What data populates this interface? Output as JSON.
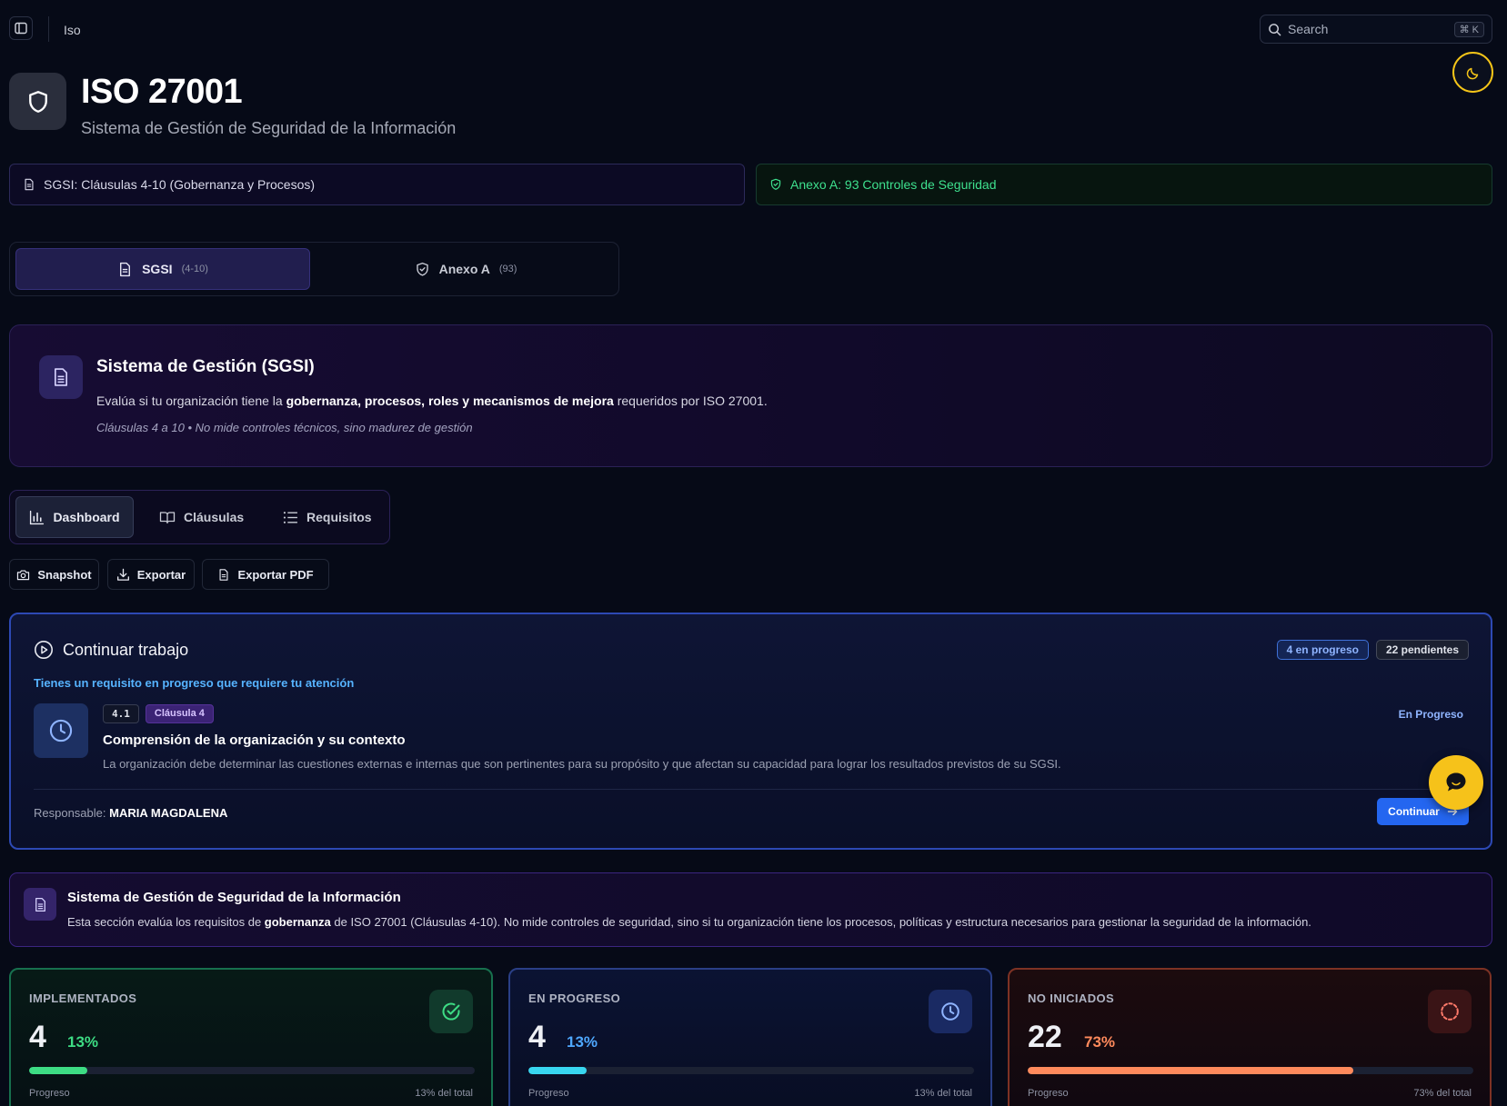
{
  "topbar": {
    "breadcrumb": "Iso",
    "search_placeholder": "Search",
    "search_shortcut": "⌘ K"
  },
  "header": {
    "title": "ISO 27001",
    "subtitle": "Sistema de Gestión de Seguridad de la Información",
    "icon": "shield-icon"
  },
  "sections": {
    "sgsi_label": "SGSI: Cláusulas 4-10 (Gobernanza y Procesos)",
    "anexo_label": "Anexo A: 93 Controles de Seguridad"
  },
  "tabs": [
    {
      "label": "SGSI",
      "count": "(4-10)",
      "active": true
    },
    {
      "label": "Anexo A",
      "count": "(93)",
      "active": false
    }
  ],
  "sgsi_card": {
    "title": "Sistema de Gestión (SGSI)",
    "desc_pre": "Evalúa si tu organización tiene la ",
    "desc_bold": "gobernanza, procesos, roles y mecanismos de mejora",
    "desc_post": " requeridos por ISO 27001.",
    "note": "Cláusulas 4 a 10 • No mide controles técnicos, sino madurez de gestión"
  },
  "view_tabs": [
    {
      "label": "Dashboard",
      "active": true
    },
    {
      "label": "Cláusulas",
      "active": false
    },
    {
      "label": "Requisitos",
      "active": false
    }
  ],
  "actions": {
    "snapshot": "Snapshot",
    "exportar": "Exportar",
    "exportar_pdf": "Exportar PDF"
  },
  "continue_work": {
    "title": "Continuar trabajo",
    "badge_progress": "4 en progreso",
    "badge_pending": "22 pendientes",
    "alert": "Tienes un requisito en progreso que requiere tu atención",
    "req_code": "4.1",
    "req_clause": "Cláusula 4",
    "req_status": "En Progreso",
    "req_title": "Comprensión de la organización y su contexto",
    "req_desc": "La organización debe determinar las cuestiones externas e internas que son pertinentes para su propósito y que afectan su capacidad para lograr los resultados previstos de su SGSI.",
    "responsable_label": "Responsable:",
    "responsable_name": "MARIA MAGDALENA",
    "continue_label": "Continuar"
  },
  "sgsi_banner": {
    "title": "Sistema de Gestión de Seguridad de la Información",
    "desc_pre": "Esta sección evalúa los requisitos de ",
    "desc_bold": "gobernanza",
    "desc_post": " de ISO 27001 (Cláusulas 4-10). No mide controles de seguridad, sino si tu organización tiene los procesos, políticas y estructura necesarios para gestionar la seguridad de la información."
  },
  "stats": [
    {
      "label": "IMPLEMENTADOS",
      "value": "4",
      "pct": "13%",
      "progress": 0.13,
      "foot_left": "Progreso",
      "foot_right": "13% del total",
      "color": "#3ddc84",
      "icon": "check-circle-icon"
    },
    {
      "label": "EN PROGRESO",
      "value": "4",
      "pct": "13%",
      "progress": 0.13,
      "foot_left": "Progreso",
      "foot_right": "13% del total",
      "color": "#38d6f0",
      "icon": "clock-icon"
    },
    {
      "label": "NO INICIADOS",
      "value": "22",
      "pct": "73%",
      "progress": 0.73,
      "foot_left": "Progreso",
      "foot_right": "73% del total",
      "color": "#ff8a5c",
      "icon": "dashed-circle-icon"
    }
  ]
}
